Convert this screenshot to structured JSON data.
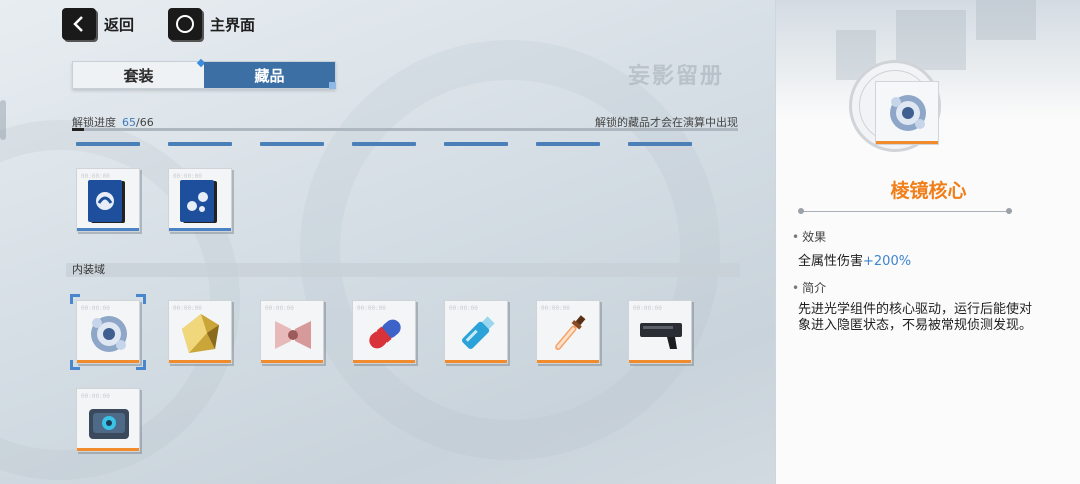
{
  "nav": {
    "back_label": "返回",
    "home_label": "主界面"
  },
  "tabs": [
    {
      "label": "套装",
      "active": false
    },
    {
      "label": "藏品",
      "active": true
    }
  ],
  "watermark_title": "妄影留册",
  "progress": {
    "label": "解锁进度",
    "current": "65",
    "total": "/66",
    "hint": "解锁的藏品才会在演算中出现",
    "fraction": 0.985
  },
  "section_inner": "内装域",
  "items_row1": [
    {
      "id": "collection-card-1",
      "icon": "blue-card-icon",
      "bar": "blue"
    },
    {
      "id": "collection-card-2",
      "icon": "blue-card-icon",
      "bar": "blue"
    }
  ],
  "items_inner": [
    {
      "id": "prism-core",
      "icon": "prism-core-icon",
      "selected": true
    },
    {
      "id": "gold-crystal",
      "icon": "gold-crystal-icon"
    },
    {
      "id": "speaker-horns",
      "icon": "speaker-horns-icon"
    },
    {
      "id": "red-blue-capsule",
      "icon": "capsule-icon"
    },
    {
      "id": "blue-usb",
      "icon": "usb-drive-icon"
    },
    {
      "id": "glowing-dagger",
      "icon": "dagger-icon"
    },
    {
      "id": "dark-device",
      "icon": "gun-device-icon"
    },
    {
      "id": "blue-module",
      "icon": "module-box-icon"
    }
  ],
  "detail": {
    "name": "棱镜核心",
    "effect_title": "效果",
    "effect_text": "全属性伤害",
    "effect_value": "+200%",
    "intro_title": "简介",
    "intro_text": "先进光学组件的核心驱动，运行后能使对象进入隐匿状态，不易被常规侦测发现。"
  },
  "colors": {
    "accent_blue": "#3c6fa3",
    "accent_orange": "#f07f1a",
    "value_blue": "#3e84d0"
  }
}
